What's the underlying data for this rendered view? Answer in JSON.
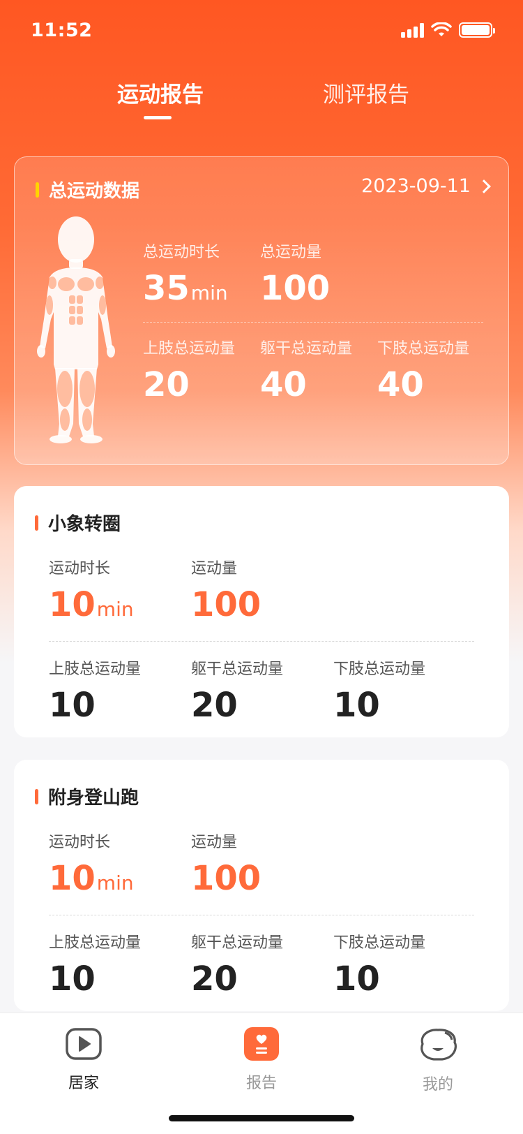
{
  "status": {
    "time": "11:52"
  },
  "tabs": [
    {
      "label": "运动报告",
      "active": true
    },
    {
      "label": "测评报告",
      "active": false
    }
  ],
  "summary": {
    "title": "总运动数据",
    "date": "2023-09-11",
    "duration_label": "总运动时长",
    "duration_value": "35",
    "duration_unit": "min",
    "volume_label": "总运动量",
    "volume_value": "100",
    "upper_label": "上肢总运动量",
    "upper_value": "20",
    "trunk_label": "躯干总运动量",
    "trunk_value": "40",
    "lower_label": "下肢总运动量",
    "lower_value": "40"
  },
  "exercises": [
    {
      "title": "小象转圈",
      "duration_label": "运动时长",
      "duration_value": "10",
      "duration_unit": "min",
      "volume_label": "运动量",
      "volume_value": "100",
      "upper_label": "上肢总运动量",
      "upper_value": "10",
      "trunk_label": "躯干总运动量",
      "trunk_value": "20",
      "lower_label": "下肢总运动量",
      "lower_value": "10"
    },
    {
      "title": "附身登山跑",
      "duration_label": "运动时长",
      "duration_value": "10",
      "duration_unit": "min",
      "volume_label": "运动量",
      "volume_value": "100",
      "upper_label": "上肢总运动量",
      "upper_value": "10",
      "trunk_label": "躯干总运动量",
      "trunk_value": "20",
      "lower_label": "下肢总运动量",
      "lower_value": "10"
    }
  ],
  "nav": [
    {
      "label": "居家",
      "icon": "play-icon",
      "selected": true
    },
    {
      "label": "报告",
      "icon": "report-heart-icon",
      "selected": false
    },
    {
      "label": "我的",
      "icon": "profile-face-icon",
      "selected": false
    }
  ],
  "colors": {
    "brand": "#ff5722",
    "accent_orange": "#ff6a3a",
    "accent_yellow": "#ffd400"
  }
}
